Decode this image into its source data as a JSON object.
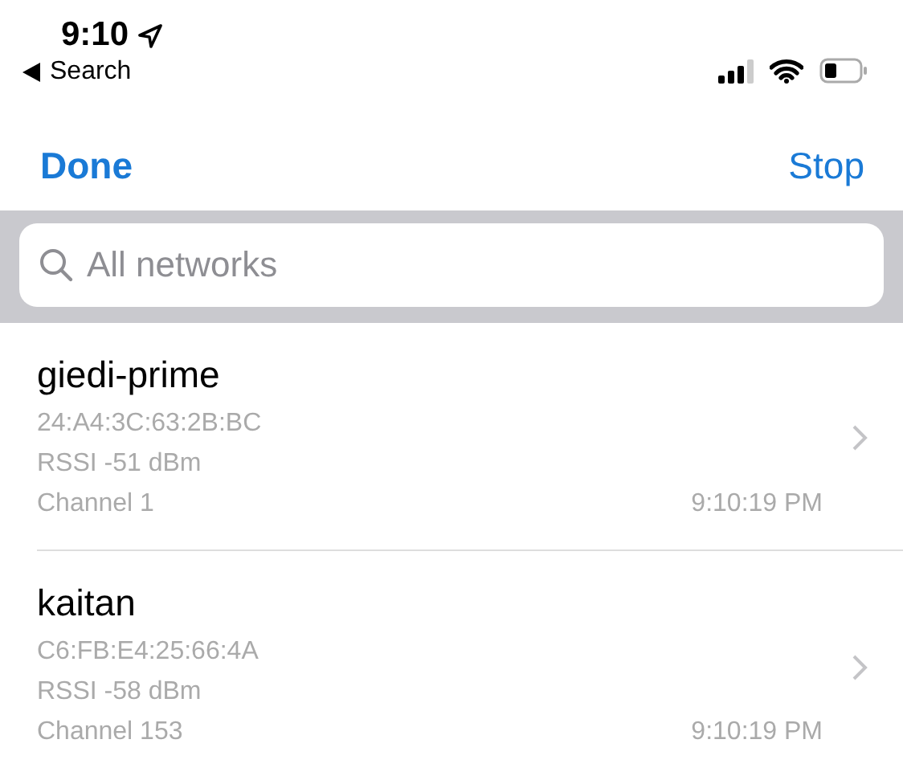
{
  "status_bar": {
    "time": "9:10",
    "back_label": "Search"
  },
  "nav": {
    "left": "Done",
    "right": "Stop"
  },
  "search": {
    "placeholder": "All networks"
  },
  "networks": [
    {
      "name": "giedi-prime",
      "bssid": "24:A4:3C:63:2B:BC",
      "rssi": "RSSI -51 dBm",
      "channel": "Channel 1",
      "time": "9:10:19 PM"
    },
    {
      "name": "kaitan",
      "bssid": "C6:FB:E4:25:66:4A",
      "rssi": "RSSI -58 dBm",
      "channel": "Channel 153",
      "time": "9:10:19 PM"
    }
  ]
}
